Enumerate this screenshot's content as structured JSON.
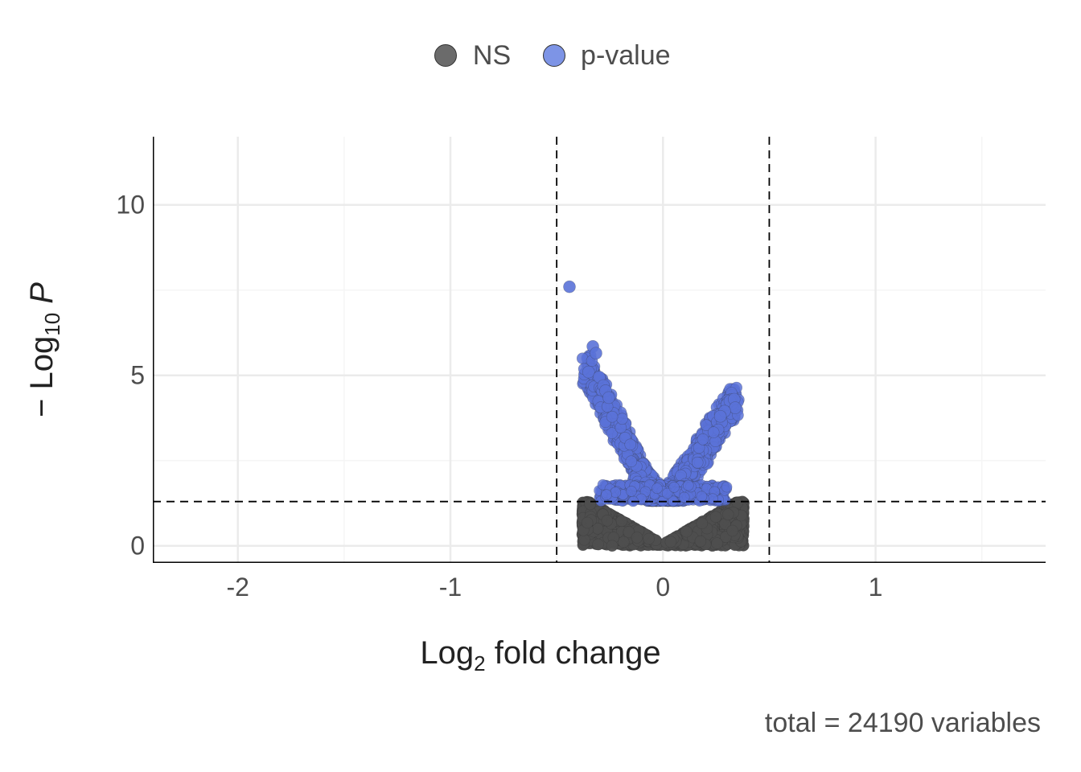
{
  "chart_data": {
    "type": "scatter",
    "title": "",
    "xlabel": "Log2 fold change",
    "ylabel": "-Log10 P",
    "xlim": [
      -2.4,
      1.8
    ],
    "ylim": [
      -0.5,
      12
    ],
    "x_ticks": [
      -2,
      -1,
      0,
      1
    ],
    "y_ticks": [
      0,
      5,
      10
    ],
    "horizontal_threshold": 1.3,
    "vertical_thresholds": [
      -0.5,
      0.5
    ],
    "legend": [
      {
        "label": "NS",
        "color": "#6b6b6b"
      },
      {
        "label": "p-value",
        "color": "#7d94e6"
      }
    ],
    "caption": "total = 24190 variables",
    "series": [
      {
        "name": "NS",
        "color": "#6b6b6b",
        "note": "Dense cloud of ~many thousands of non-significant points forming a filled V-base near origin; approximate envelope x in [-0.35, 0.35], y in [0, 1.3].",
        "approx_count": 22000
      },
      {
        "name": "p-value",
        "color": "#7d94e6",
        "note": "Significant points (y > 1.3) forming two arms of a volcano; left arm reaches x≈-0.45 y≈7.6, right arm reaches x≈0.35 y≈4.3.",
        "approx_count": 2190,
        "representative_points": [
          {
            "x": -0.44,
            "y": 7.6
          },
          {
            "x": -0.33,
            "y": 5.8
          },
          {
            "x": -0.31,
            "y": 5.7
          },
          {
            "x": -0.35,
            "y": 5.1
          },
          {
            "x": -0.3,
            "y": 4.9
          },
          {
            "x": -0.27,
            "y": 4.7
          },
          {
            "x": -0.25,
            "y": 4.0
          },
          {
            "x": -0.22,
            "y": 3.5
          },
          {
            "x": -0.18,
            "y": 2.8
          },
          {
            "x": -0.12,
            "y": 2.0
          },
          {
            "x": 0.12,
            "y": 2.0
          },
          {
            "x": 0.18,
            "y": 2.8
          },
          {
            "x": 0.24,
            "y": 3.5
          },
          {
            "x": 0.3,
            "y": 4.1
          },
          {
            "x": 0.33,
            "y": 4.3
          },
          {
            "x": 0.35,
            "y": 4.2
          }
        ]
      }
    ]
  },
  "legend_labels": {
    "ns": "NS",
    "pv": "p-value"
  },
  "xlabel_parts": {
    "pre": "Log",
    "sub": "2",
    "post": " fold change"
  },
  "ylabel_parts": {
    "pre": "− Log",
    "sub": "10",
    "post": " ",
    "ital": "P"
  },
  "caption": "total = 24190 variables",
  "xticks": [
    "-2",
    "-1",
    "0",
    "1"
  ],
  "yticks": [
    "0",
    "5",
    "10"
  ]
}
